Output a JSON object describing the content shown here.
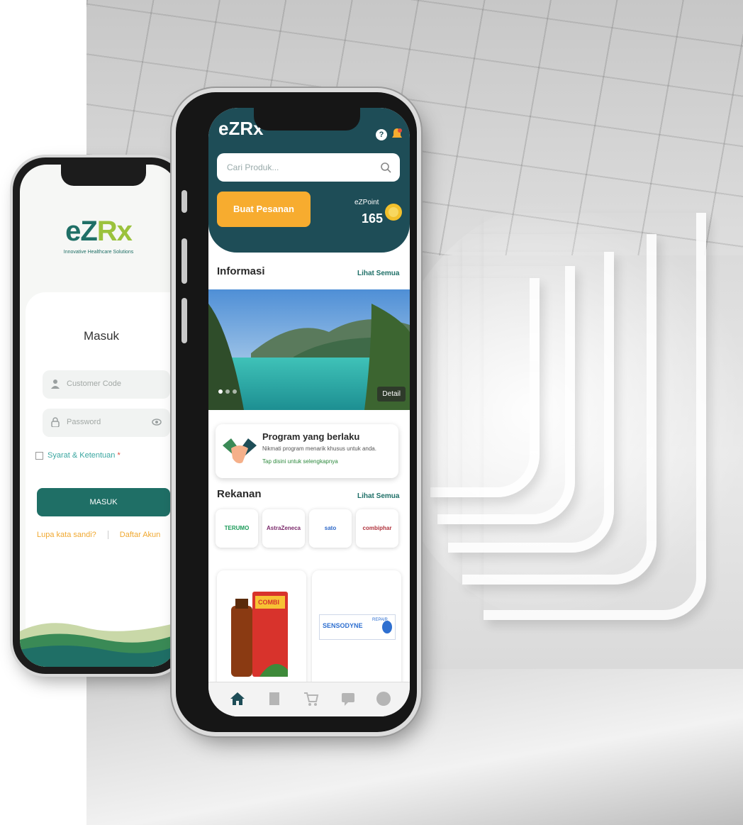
{
  "login_screen": {
    "logo": "eZRx",
    "tagline": "Innovative Healthcare Solutions",
    "title": "Masuk",
    "customer_code_placeholder": "Customer Code",
    "password_placeholder": "Password",
    "terms_label": "Syarat & Ketentuan",
    "terms_required_mark": "*",
    "submit_label": "MASUK",
    "forgot_password": "Lupa kata sandi?",
    "register": "Daftar Akun"
  },
  "home_screen": {
    "brand": "eZRx",
    "help_label": "?",
    "search_placeholder": "Cari Produk...",
    "order_button": "Buat Pesanan",
    "ezpoint_label": "eZPoint",
    "ezpoint_value": "165",
    "info_section": {
      "title": "Informasi",
      "see_all": "Lihat Semua"
    },
    "banner": {
      "detail_label": "Detail",
      "dot_count": 3,
      "active_dot": 1
    },
    "program_card": {
      "title": "Program yang berlaku",
      "description": "Nikmati program menarik khusus untuk anda.",
      "link": "Tap disini untuk selengkapnya"
    },
    "partners_section": {
      "title": "Rekanan",
      "see_all": "Lihat Semua"
    },
    "partners": [
      {
        "name": "TERUMO",
        "color": "#1a9a58"
      },
      {
        "name": "AstraZeneca",
        "color": "#7b2a6b"
      },
      {
        "name": "sato",
        "color": "#2a66c7"
      },
      {
        "name": "combiphar",
        "color": "#b0323c"
      }
    ],
    "products": [
      {
        "name": "COMBI",
        "brand_color": "#d8332c"
      },
      {
        "name": "SENSODYNE",
        "sub_label": "REPAIR",
        "brand_color": "#2e6fd0"
      }
    ],
    "tabbar": [
      "home-icon",
      "document-icon",
      "cart-icon",
      "chat-icon",
      "profile-icon"
    ]
  },
  "colors": {
    "primary": "#1e4d57",
    "login_primary": "#1f6f66",
    "accent": "#f7ac2f",
    "logo_green": "#9bc23c"
  }
}
